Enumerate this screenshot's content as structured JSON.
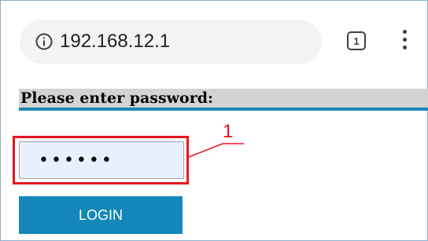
{
  "browser": {
    "url": "192.168.12.1",
    "tab_count": "1",
    "icons": {
      "info": "info-icon",
      "menu": "more-vert-icon"
    }
  },
  "form": {
    "prompt": "Please enter password:",
    "password_value": "••••••",
    "login_label": "LOGIN"
  },
  "annotation": {
    "callout_number": "1"
  },
  "colors": {
    "accent": "#1287b8",
    "prompt_bg": "#d3d3d3",
    "highlight": "#e8141f",
    "field_bg": "#e8f0fe"
  }
}
